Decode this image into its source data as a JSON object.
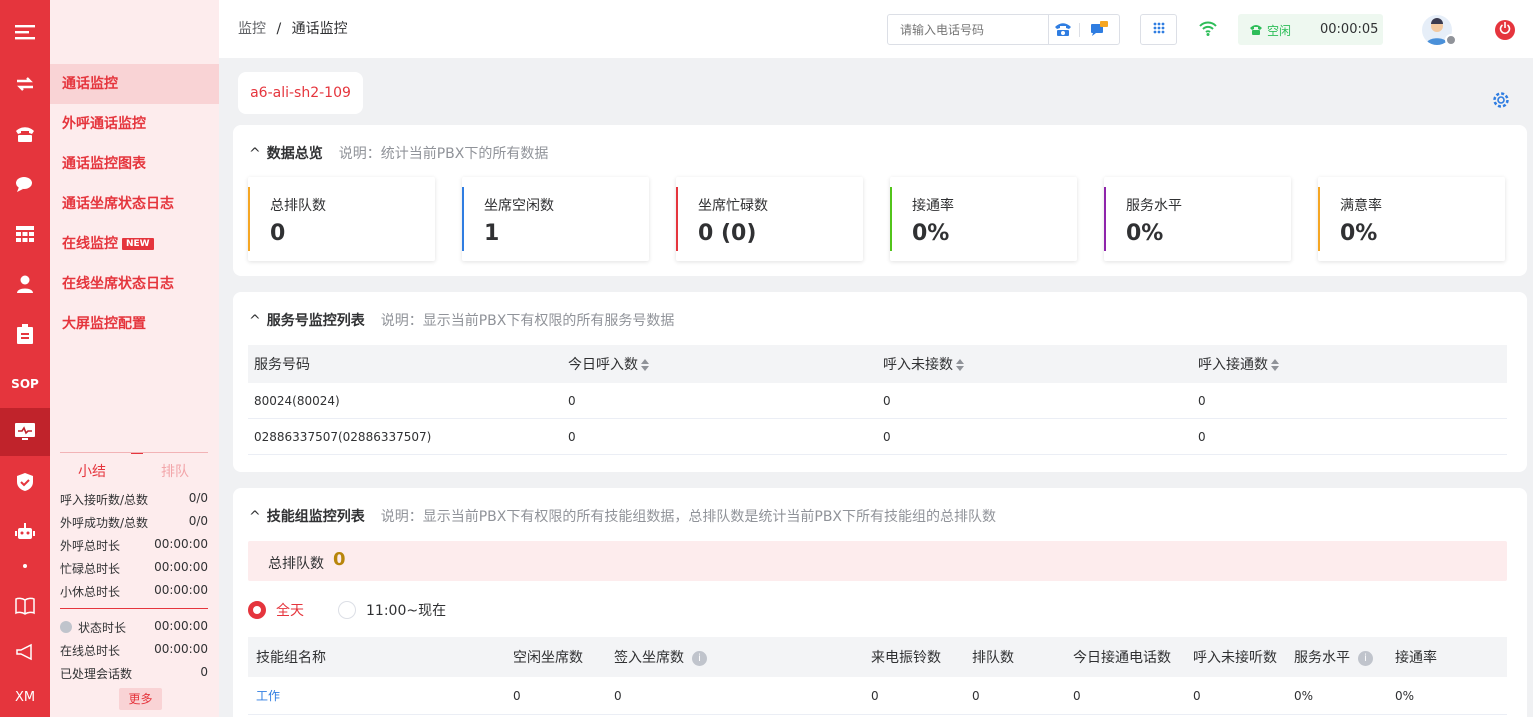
{
  "rail": {
    "items": [
      {
        "icon": "menu-icon"
      },
      {
        "icon": "transfer-icon"
      },
      {
        "icon": "phone-icon"
      },
      {
        "icon": "chat-icon"
      },
      {
        "icon": "grid-icon"
      },
      {
        "icon": "agent-icon"
      },
      {
        "icon": "clipboard-icon"
      },
      {
        "icon": "sop-icon",
        "text": "SOP"
      },
      {
        "icon": "monitor-icon"
      },
      {
        "icon": "shield-icon"
      },
      {
        "icon": "robot-icon"
      },
      {
        "icon": "book-icon"
      },
      {
        "icon": "megaphone-icon"
      },
      {
        "icon": "xm-icon",
        "text": "XM"
      }
    ],
    "accent": "#e5353d"
  },
  "submenu": {
    "items": [
      "通话监控",
      "外呼通话监控",
      "通话监控图表",
      "通话坐席状态日志",
      "在线监控",
      "在线坐席状态日志",
      "大屏监控配置"
    ],
    "new_badge": "NEW"
  },
  "summary": {
    "tabs": [
      "小结",
      "排队"
    ],
    "rows": [
      {
        "label": "呼入接听数/总数",
        "value": "0/0"
      },
      {
        "label": "外呼成功数/总数",
        "value": "0/0"
      },
      {
        "label": "外呼总时长",
        "value": "00:00:00"
      },
      {
        "label": "忙碌总时长",
        "value": "00:00:00"
      },
      {
        "label": "小休总时长",
        "value": "00:00:00"
      }
    ],
    "rows2": [
      {
        "label": "状态时长",
        "value": "00:00:00"
      },
      {
        "label": "在线总时长",
        "value": "00:00:00"
      },
      {
        "label": "已处理会话数",
        "value": "0"
      }
    ],
    "more": "更多"
  },
  "header": {
    "crumb_root": "监控",
    "crumb_sep": "/",
    "crumb_current": "通话监控",
    "phone_placeholder": "请输入电话号码",
    "status_label": "空闲",
    "timer": "00:00:05"
  },
  "main": {
    "pbx_tag": "a6-ali-sh2-109",
    "overview": {
      "title": "数据总览",
      "note": "说明：统计当前PBX下的所有数据",
      "cards": [
        {
          "label": "总排队数",
          "value": "0",
          "color": "#f5a623"
        },
        {
          "label": "坐席空闲数",
          "value": "1",
          "color": "#2f7de1"
        },
        {
          "label": "坐席忙碌数",
          "value": "0 (0)",
          "color": "#e5353d"
        },
        {
          "label": "接通率",
          "value": "0%",
          "color": "#52c41a"
        },
        {
          "label": "服务水平",
          "value": "0%",
          "color": "#8e24aa"
        },
        {
          "label": "满意率",
          "value": "0%",
          "color": "#f5a623"
        }
      ]
    },
    "service": {
      "title": "服务号监控列表",
      "note": "说明：显示当前PBX下有权限的所有服务号数据",
      "columns": [
        "服务号码",
        "今日呼入数",
        "呼入未接数",
        "呼入接通数"
      ],
      "rows": [
        [
          "80024(80024)",
          "0",
          "0",
          "0"
        ],
        [
          "02886337507(02886337507)",
          "0",
          "0",
          "0"
        ]
      ]
    },
    "skill": {
      "title": "技能组监控列表",
      "note": "说明：显示当前PBX下有权限的所有技能组数据，总排队数是统计当前PBX下所有技能组的总排队数",
      "queue_label": "总排队数",
      "queue_value": "0",
      "radios": [
        "全天",
        "11:00~现在"
      ],
      "columns": [
        "技能组名称",
        "空闲坐席数",
        "签入坐席数",
        "来电振铃数",
        "排队数",
        "今日接通电话数",
        "呼入未接听数",
        "服务水平",
        "接通率"
      ],
      "rows": [
        [
          "工作",
          "0",
          "0",
          "0",
          "0",
          "0",
          "0",
          "0%",
          "0%"
        ]
      ]
    }
  }
}
